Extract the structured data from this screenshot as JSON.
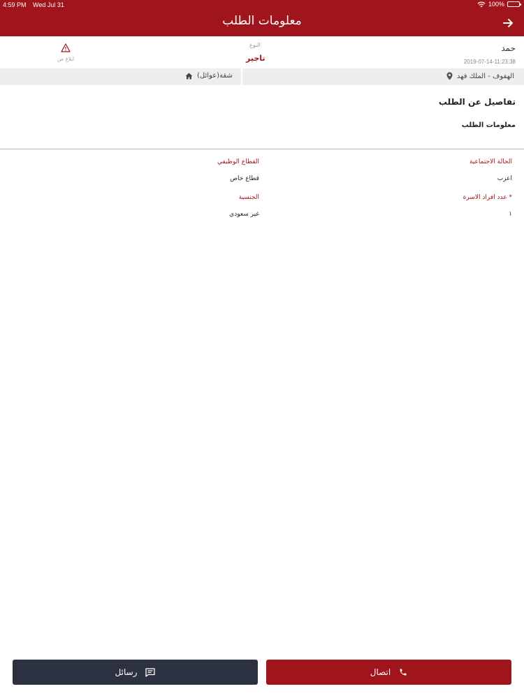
{
  "status": {
    "time": "4:59 PM",
    "date": "Wed Jul 31",
    "battery": "100%"
  },
  "header": {
    "title": "معلومات الطلب"
  },
  "request": {
    "name": "حمد",
    "datetime": "2019-07-14-11:23:38",
    "type_label": "النوع",
    "type_value": "تاجير",
    "report_label": "ابلاغ عن"
  },
  "location": {
    "address": "الهفوف - الملك فهد",
    "property": "شقة(عوائل)"
  },
  "details": {
    "section_title": "تفاصيل عن الطلب",
    "subsection_title": "معلومات الطلب",
    "fields": [
      {
        "label": "الحالة الاجتماعية",
        "value": "اعزب"
      },
      {
        "label": "القطاع الوظيفي",
        "value": "قطاع خاص"
      },
      {
        "label": "عدد افراد الاسرة *",
        "value": "١"
      },
      {
        "label": "الجنسية",
        "value": "غير سعودي"
      }
    ]
  },
  "actions": {
    "messages_label": "رسائل",
    "call_label": "اتصال"
  },
  "colors": {
    "primary": "#a0141c",
    "dark": "#2b3140",
    "locbar": "#eeeeee"
  }
}
